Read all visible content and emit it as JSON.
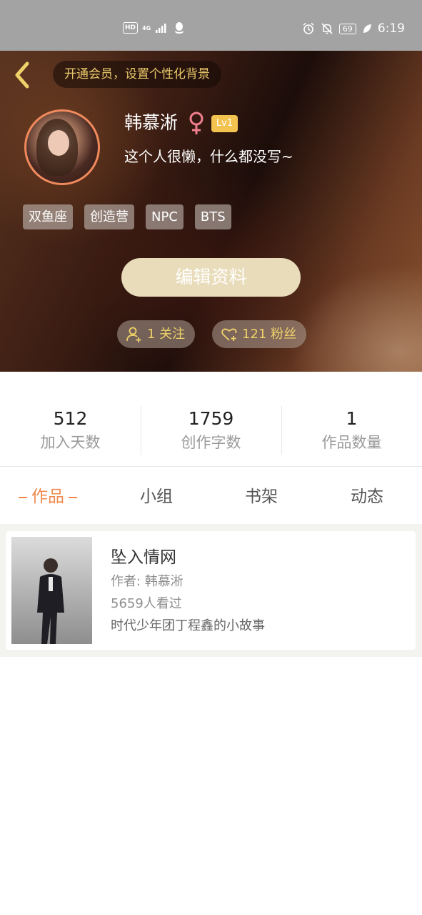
{
  "status_bar": {
    "network": "4G",
    "hd": "HD",
    "battery": "69",
    "time": "6:19"
  },
  "header": {
    "vip_text": "开通会员，设置个性化背景",
    "username": "韩慕淅",
    "level": "Lv1",
    "signature": "这个人很懒，什么都没写~",
    "tags": [
      "双鱼座",
      "创造营",
      "NPC",
      "BTS"
    ],
    "edit_button": "编辑资料",
    "following": "1 关注",
    "fans": "121 粉丝"
  },
  "stats": [
    {
      "value": "512",
      "label": "加入天数"
    },
    {
      "value": "1759",
      "label": "创作字数"
    },
    {
      "value": "1",
      "label": "作品数量"
    }
  ],
  "tabs": [
    {
      "label": "作品",
      "active": true
    },
    {
      "label": "小组",
      "active": false
    },
    {
      "label": "书架",
      "active": false
    },
    {
      "label": "动态",
      "active": false
    }
  ],
  "works": [
    {
      "title": "坠入情网",
      "author": "作者: 韩慕淅",
      "views": "5659人看过",
      "description": "时代少年团丁程鑫的小故事"
    }
  ],
  "colors": {
    "accent": "#ef8a4f",
    "gold": "#f0d26a",
    "level_badge": "#f3c350",
    "female_icon": "#ef7e8e",
    "edit_button": "#e9dcba"
  },
  "icons": [
    "back-arrow-icon",
    "female-icon",
    "add-user-icon",
    "heart-plus-icon",
    "alarm-icon",
    "mute-icon",
    "leaf-icon",
    "qq-icon",
    "signal-icon"
  ]
}
